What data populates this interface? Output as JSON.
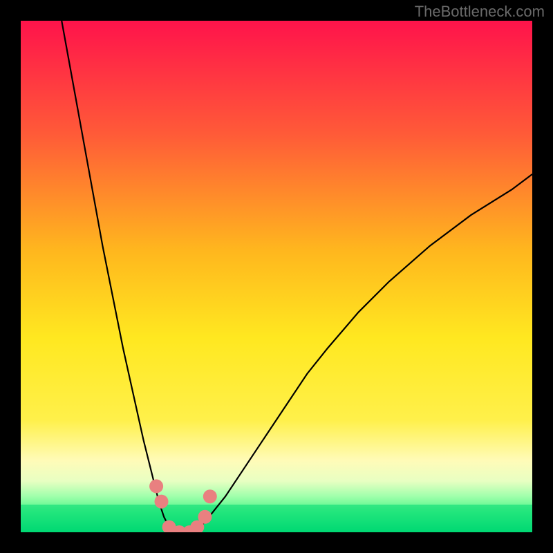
{
  "watermark": "TheBottleneck.com",
  "chart_data": {
    "type": "line",
    "title": "",
    "xlabel": "",
    "ylabel": "",
    "xlim": [
      0,
      100
    ],
    "ylim": [
      0,
      100
    ],
    "background_gradient": {
      "top": "#ff134b",
      "upper_mid": "#ff8a2a",
      "mid": "#ffe820",
      "lower": "#fff79a",
      "band": "#5cff8f",
      "bottom": "#00e277"
    },
    "series": [
      {
        "name": "left-curve",
        "type": "line",
        "x": [
          8,
          10,
          12,
          14,
          16,
          18,
          20,
          22,
          24,
          26,
          27,
          28,
          29,
          30
        ],
        "y": [
          100,
          89,
          78,
          67,
          56,
          46,
          36,
          27,
          18,
          10,
          6,
          3,
          1,
          0
        ]
      },
      {
        "name": "right-curve",
        "type": "line",
        "x": [
          34,
          36,
          40,
          44,
          48,
          52,
          56,
          60,
          66,
          72,
          80,
          88,
          96,
          100
        ],
        "y": [
          0,
          2,
          7,
          13,
          19,
          25,
          31,
          36,
          43,
          49,
          56,
          62,
          67,
          70
        ]
      },
      {
        "name": "valley-markers",
        "type": "scatter",
        "x": [
          26.5,
          27.5,
          29,
          31,
          33,
          34.5,
          36,
          37
        ],
        "y": [
          9,
          6,
          1,
          0,
          0,
          1,
          3,
          7
        ],
        "color": "#e98080",
        "size": 10
      }
    ]
  }
}
